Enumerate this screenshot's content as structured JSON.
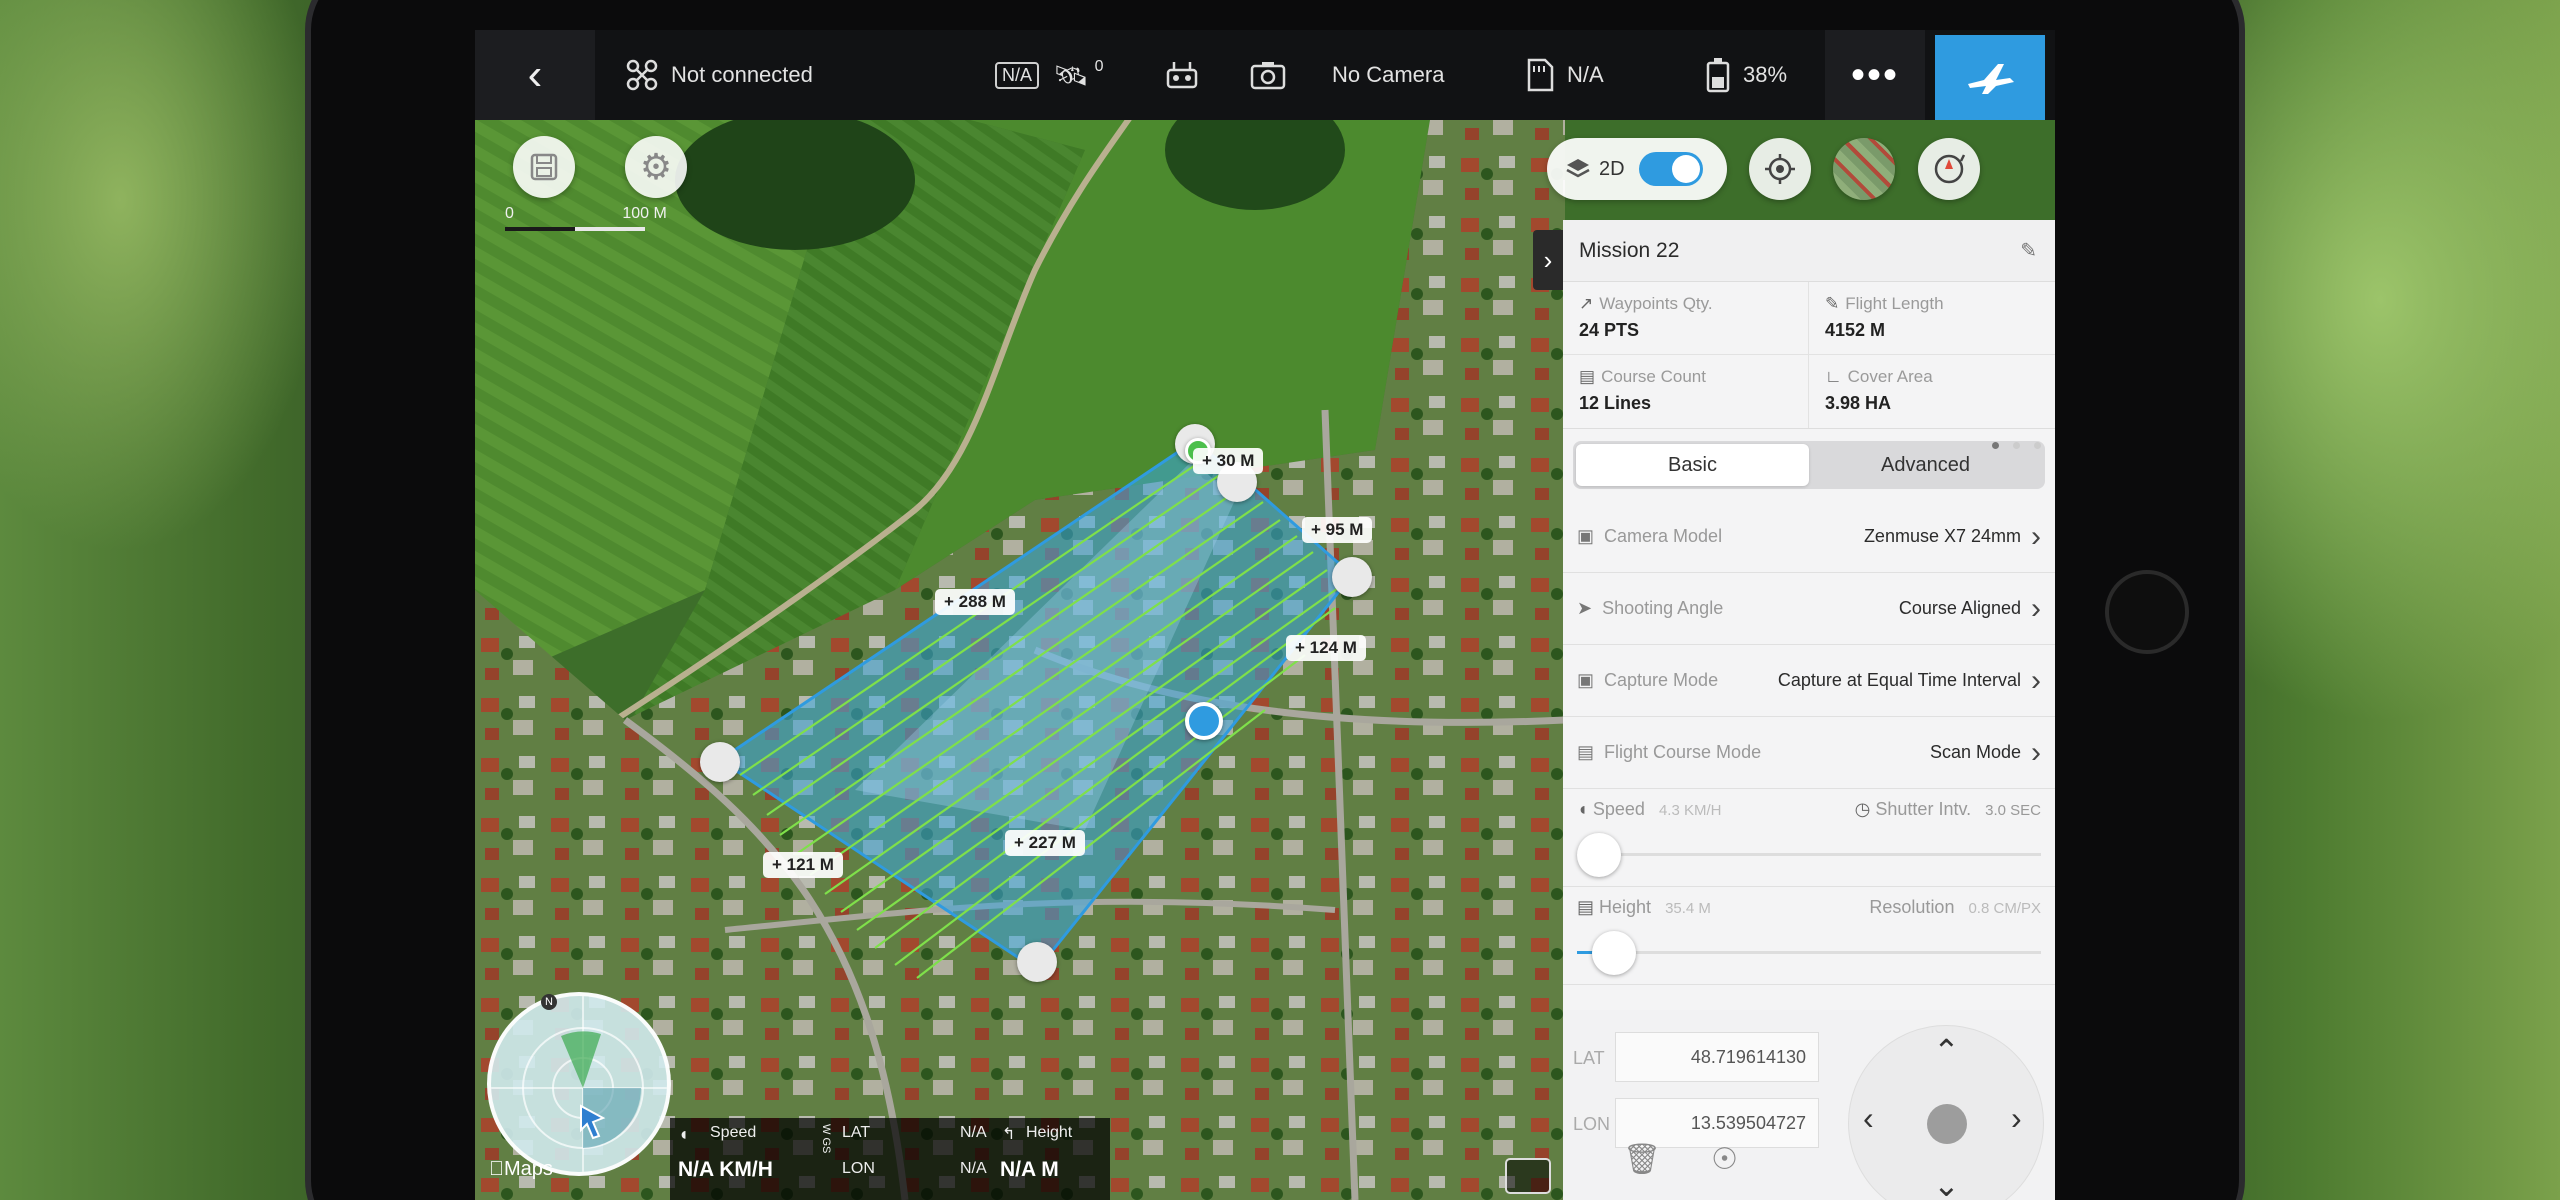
{
  "topbar": {
    "status": "Not connected",
    "gps_label": "N/A",
    "satellite_count": "0",
    "camera": "No Camera",
    "storage": "N/A",
    "battery": "38%"
  },
  "map": {
    "scale_start": "0",
    "scale_end": "100 M",
    "view_mode": "2D",
    "measurements": {
      "top": "30 M",
      "right_upper": "95 M",
      "left_long": "288 M",
      "right_lower": "124 M",
      "bottom_long": "227 M",
      "left_short": "121 M"
    },
    "north_label": "N",
    "attribution": "Maps"
  },
  "panel": {
    "mission_title": "Mission 22",
    "stats": [
      {
        "label": "Waypoints Qty.",
        "value": "24 PTS"
      },
      {
        "label": "Flight Length",
        "value": "4152 M"
      },
      {
        "label": "Course Count",
        "value": "12 Lines"
      },
      {
        "label": "Cover Area",
        "value": "3.98 HA"
      }
    ],
    "tabs": [
      "Basic",
      "Advanced"
    ],
    "settings": [
      {
        "label": "Camera Model",
        "value": "Zenmuse X7 24mm"
      },
      {
        "label": "Shooting Angle",
        "value": "Course Aligned"
      },
      {
        "label": "Capture Mode",
        "value": "Capture at Equal Time Interval"
      },
      {
        "label": "Flight Course Mode",
        "value": "Scan Mode"
      }
    ],
    "speed": {
      "label": "Speed",
      "value": "4.3 KM/H",
      "interval_label": "Shutter Intv.",
      "interval_value": "3.0 SEC",
      "level": 0.03
    },
    "height": {
      "label": "Height",
      "value": "35.4 M",
      "resolution_label": "Resolution",
      "resolution_value": "0.8 CM/PX",
      "level": 0.08
    },
    "lat_label": "LAT",
    "lat_value": "48.719614130",
    "lon_label": "LON",
    "lon_value": "13.539504727"
  },
  "telemetry": {
    "speed_label": "Speed",
    "speed_value": "N/A KM/H",
    "lat_label": "LAT",
    "lat_value": "N/A",
    "lon_label": "LON",
    "lon_value": "N/A",
    "height_label": "Height",
    "height_value": "N/A M"
  },
  "colors": {
    "accent": "#2f9be0",
    "mission_area": "#3aa7e0",
    "flight_lines": "#7fe04a"
  }
}
